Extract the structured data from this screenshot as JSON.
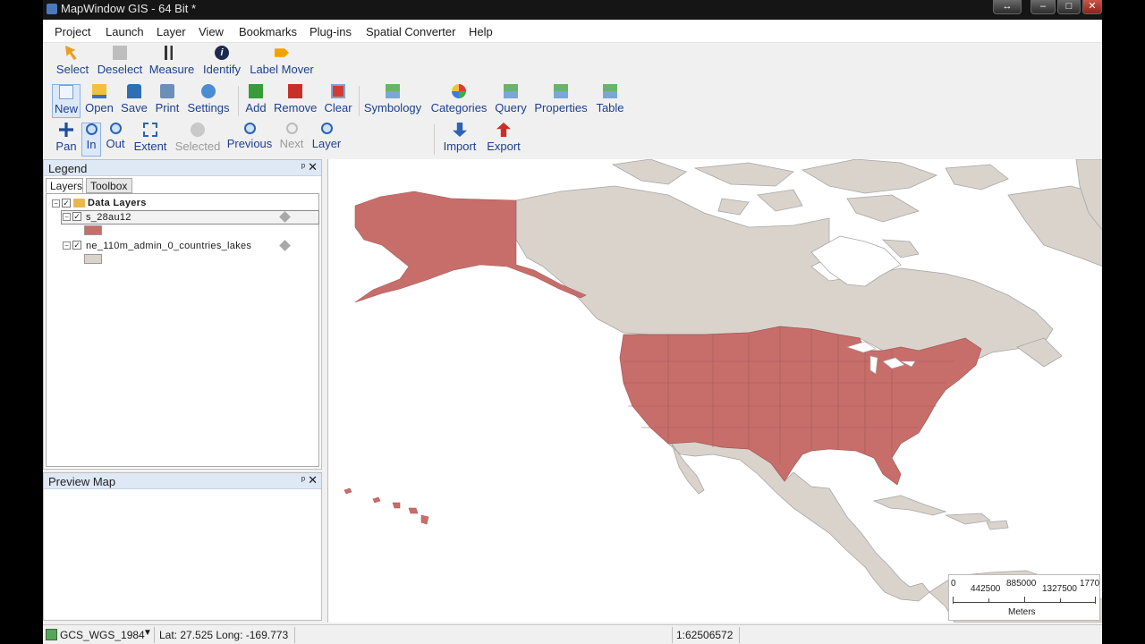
{
  "window": {
    "title": "MapWindow GIS - 64 Bit *"
  },
  "menu": [
    "Project",
    "Launch",
    "Layer",
    "View",
    "Bookmarks",
    "Plug-ins",
    "Spatial Converter",
    "Help"
  ],
  "toolbar_row1": [
    "Select",
    "Deselect",
    "Measure",
    "Identify",
    "Label Mover"
  ],
  "toolbar_row2": [
    "New",
    "Open",
    "Save",
    "Print",
    "Settings",
    "Add",
    "Remove",
    "Clear",
    "Symbology",
    "Categories",
    "Query",
    "Properties",
    "Table"
  ],
  "toolbar_row3": [
    "Pan",
    "In",
    "Out",
    "Extent",
    "Selected",
    "Previous",
    "Next",
    "Layer",
    "Import",
    "Export"
  ],
  "legend": {
    "title": "Legend",
    "pin": "ᵖ",
    "close": "✕",
    "tabs": [
      "Layers",
      "Toolbox"
    ],
    "group": "Data Layers",
    "layers": [
      {
        "name": "s_28au12",
        "swatch": "#c76e6b"
      },
      {
        "name": "ne_110m_admin_0_countries_lakes",
        "swatch": "#d9d3cc"
      }
    ]
  },
  "preview": {
    "title": "Preview Map",
    "close": "✕"
  },
  "scalebar": {
    "labels": [
      "0",
      "442500",
      "885000",
      "1327500",
      "1770"
    ],
    "unit": "Meters"
  },
  "status": {
    "projection": "GCS_WGS_1984",
    "coords": "Lat: 27.525 Long: -169.773",
    "scale": "1:62506572"
  },
  "colors": {
    "us_fill": "#c76e6b",
    "land_fill": "#d9d3cc",
    "border": "#9b9b9b"
  },
  "icons": [
    "select-icon",
    "deselect-icon",
    "measure-icon",
    "identify-icon",
    "label-mover-icon",
    "new-icon",
    "open-icon",
    "save-icon",
    "print-icon",
    "settings-icon",
    "add-layer-icon",
    "remove-layer-icon",
    "clear-icon",
    "symbology-icon",
    "categories-icon",
    "query-icon",
    "properties-icon",
    "table-icon",
    "pan-icon",
    "zoom-in-icon",
    "zoom-out-icon",
    "zoom-extent-icon",
    "zoom-selected-icon",
    "previous-extent-icon",
    "next-extent-icon",
    "zoom-layer-icon",
    "import-icon",
    "export-icon"
  ]
}
